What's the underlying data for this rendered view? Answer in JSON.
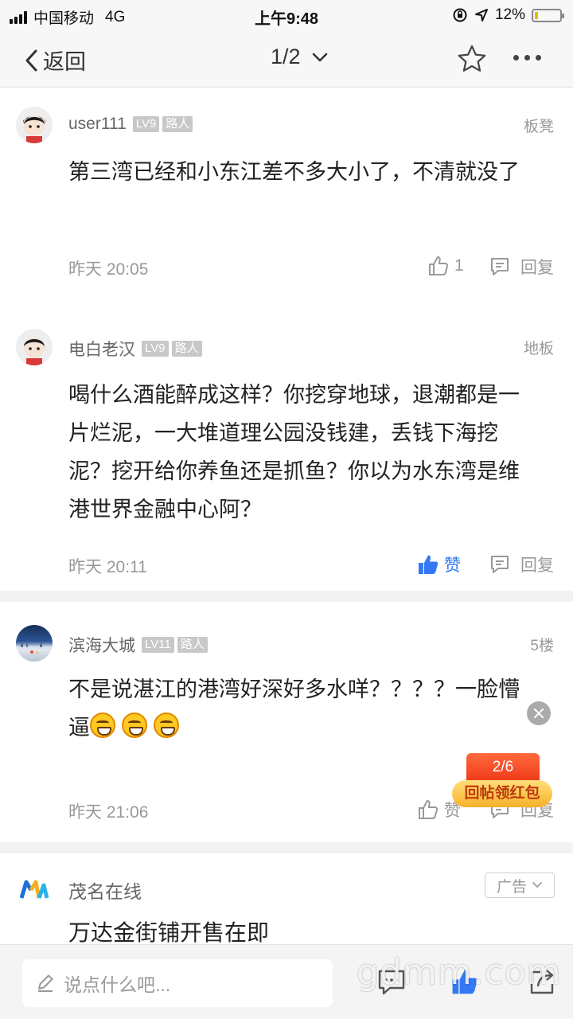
{
  "status_bar": {
    "carrier": "中国移动",
    "network": "4G",
    "time": "上午9:48",
    "battery_percent": "12%",
    "battery_level": 0.12
  },
  "nav": {
    "back_label": "返回",
    "page_indicator": "1/2"
  },
  "comments": [
    {
      "username": "user111",
      "level": "LV9",
      "role": "路人",
      "floor": "板凳",
      "text": "第三湾已经和小东江差不多大小了，不清就没了",
      "time": "昨天 20:05",
      "like_label": "1",
      "liked": false,
      "reply_label": "回复"
    },
    {
      "username": "电白老汉",
      "level": "LV9",
      "role": "路人",
      "floor": "地板",
      "text": "喝什么酒能醉成这样？你挖穿地球，退潮都是一片烂泥，一大堆道理公园没钱建，丢钱下海挖泥？挖开给你养鱼还是抓鱼？你以为水东湾是维港世界金融中心阿？",
      "time": "昨天 20:11",
      "like_label": "赞",
      "liked": true,
      "reply_label": "回复"
    },
    {
      "username": "滨海大城",
      "level": "LV11",
      "role": "路人",
      "floor": "5楼",
      "text": "不是说湛江的港湾好深好多水咩？？？？一脸懵逼",
      "time": "昨天 21:06",
      "like_label": "赞",
      "liked": false,
      "reply_label": "回复"
    }
  ],
  "red_packet": {
    "progress": "2/6",
    "label": "回帖领红包"
  },
  "ad": {
    "source": "茂名在线",
    "tag": "广告",
    "title": "万达金街铺开售在即"
  },
  "bottom_bar": {
    "reply_placeholder": "说点什么吧..."
  },
  "watermark": "gdmm.com",
  "colors": {
    "accent_blue": "#3478f6",
    "red_packet_red": "#ee3a1a",
    "red_packet_gold": "#f5b22a",
    "battery_yellow": "#f0b400"
  },
  "icons": [
    "signal-icon",
    "lock-rotation-icon",
    "location-icon",
    "battery-icon",
    "back-chevron-icon",
    "dropdown-chevron-icon",
    "star-icon",
    "more-icon",
    "thumb-up-icon",
    "comment-icon",
    "close-icon",
    "pencil-icon",
    "share-icon"
  ]
}
